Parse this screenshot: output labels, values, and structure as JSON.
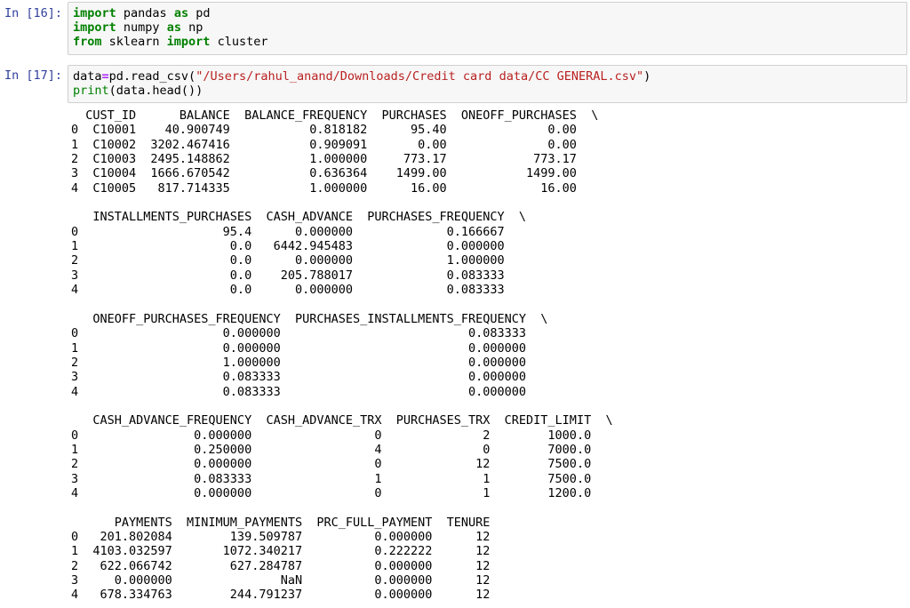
{
  "cells": [
    {
      "prompt": "In [16]:",
      "lines": [
        [
          {
            "t": "import",
            "c": "kw"
          },
          {
            "t": " pandas ",
            "c": ""
          },
          {
            "t": "as",
            "c": "kw"
          },
          {
            "t": " pd",
            "c": ""
          }
        ],
        [
          {
            "t": "import",
            "c": "kw"
          },
          {
            "t": " numpy ",
            "c": ""
          },
          {
            "t": "as",
            "c": "kw"
          },
          {
            "t": " np",
            "c": ""
          }
        ],
        [
          {
            "t": "from",
            "c": "kw"
          },
          {
            "t": " sklearn ",
            "c": ""
          },
          {
            "t": "import",
            "c": "kw"
          },
          {
            "t": " cluster",
            "c": ""
          }
        ]
      ]
    },
    {
      "prompt": "In [17]:",
      "lines": [
        [
          {
            "t": "data",
            "c": ""
          },
          {
            "t": "=",
            "c": "op"
          },
          {
            "t": "pd.read_csv(",
            "c": ""
          },
          {
            "t": "\"/Users/rahul_anand/Downloads/Credit card data/CC GENERAL.csv\"",
            "c": "str"
          },
          {
            "t": ")",
            "c": ""
          }
        ],
        [
          {
            "t": "print",
            "c": "fn"
          },
          {
            "t": "(data.head())",
            "c": ""
          }
        ]
      ]
    }
  ],
  "output_lines": [
    "  CUST_ID      BALANCE  BALANCE_FREQUENCY  PURCHASES  ONEOFF_PURCHASES  \\",
    "0  C10001    40.900749           0.818182      95.40              0.00   ",
    "1  C10002  3202.467416           0.909091       0.00              0.00   ",
    "2  C10003  2495.148862           1.000000     773.17            773.17   ",
    "3  C10004  1666.670542           0.636364    1499.00           1499.00   ",
    "4  C10005   817.714335           1.000000      16.00             16.00   ",
    "",
    "   INSTALLMENTS_PURCHASES  CASH_ADVANCE  PURCHASES_FREQUENCY  \\",
    "0                    95.4      0.000000             0.166667   ",
    "1                     0.0   6442.945483             0.000000   ",
    "2                     0.0      0.000000             1.000000   ",
    "3                     0.0    205.788017             0.083333   ",
    "4                     0.0      0.000000             0.083333   ",
    "",
    "   ONEOFF_PURCHASES_FREQUENCY  PURCHASES_INSTALLMENTS_FREQUENCY  \\",
    "0                    0.000000                          0.083333   ",
    "1                    0.000000                          0.000000   ",
    "2                    1.000000                          0.000000   ",
    "3                    0.083333                          0.000000   ",
    "4                    0.083333                          0.000000   ",
    "",
    "   CASH_ADVANCE_FREQUENCY  CASH_ADVANCE_TRX  PURCHASES_TRX  CREDIT_LIMIT  \\",
    "0                0.000000                 0              2        1000.0   ",
    "1                0.250000                 4              0        7000.0   ",
    "2                0.000000                 0             12        7500.0   ",
    "3                0.083333                 1              1        7500.0   ",
    "4                0.000000                 0              1        1200.0   ",
    "",
    "      PAYMENTS  MINIMUM_PAYMENTS  PRC_FULL_PAYMENT  TENURE  ",
    "0   201.802084        139.509787          0.000000      12  ",
    "1  4103.032597       1072.340217          0.222222      12  ",
    "2   622.066742        627.284787          0.000000      12  ",
    "3     0.000000               NaN          0.000000      12  ",
    "4   678.334763        244.791237          0.000000      12  "
  ],
  "colors": {
    "prompt": "#303f9f",
    "keyword": "#008000",
    "string": "#ba2121",
    "operator": "#aa22ff",
    "cell_background": "#f7f7f7",
    "cell_border": "#cfcfcf"
  }
}
